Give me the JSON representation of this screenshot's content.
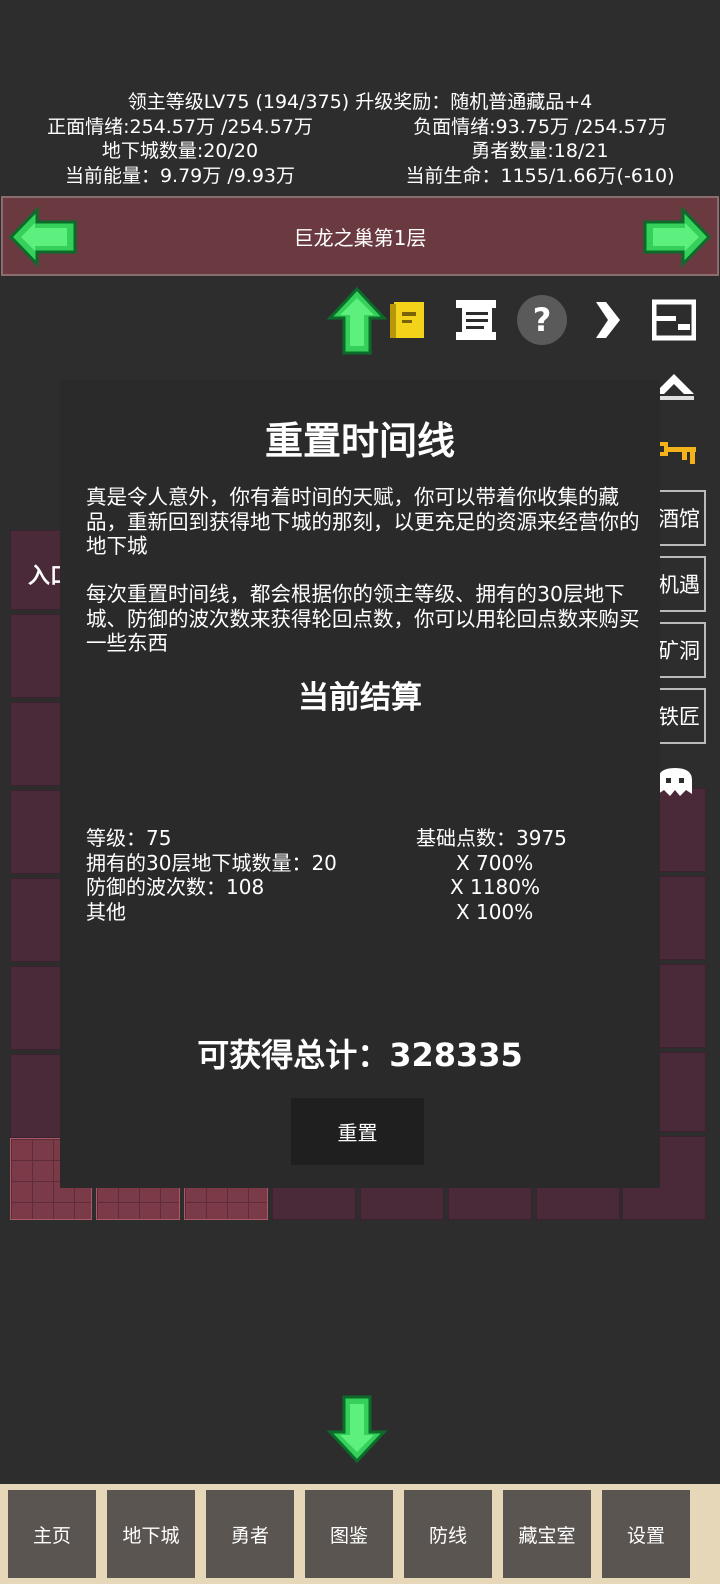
{
  "stats": {
    "lord_line": "领主等级LV75 (194/375) 升级奖励：随机普通藏品+4",
    "positive": "正面情绪:254.57万 /254.57万",
    "negative": "负面情绪:93.75万 /254.57万",
    "dungeon_count": "地下城数量:20/20",
    "hero_count": "勇者数量:18/21",
    "energy": "当前能量：9.79万 /9.93万",
    "life": "当前生命：1155/1.66万(-610)"
  },
  "banner": {
    "title": "巨龙之巢第1层"
  },
  "background": {
    "entrance_label": "入口",
    "right_tabs": [
      "酒馆",
      "机遇",
      "矿洞",
      "铁匠"
    ]
  },
  "dialog": {
    "title": "重置时间线",
    "para1": "  真是令人意外，你有着时间的天赋，你可以带着你收集的藏品，重新回到获得地下城的那刻，以更充足的资源来经营你的地下城",
    "para2": "  每次重置时间线，都会根据你的领主等级、拥有的30层地下城、防御的波次数来获得轮回点数，你可以用轮回点数来购买一些东西",
    "subtitle": "当前结算",
    "calc": [
      {
        "left": "等级：75",
        "right": "基础点数：3975"
      },
      {
        "left": "拥有的30层地下城数量：20",
        "right": "X 700%"
      },
      {
        "left": "防御的波次数：108",
        "right": "X 1180%"
      },
      {
        "left": "其他",
        "right": "X 100%"
      }
    ],
    "total": "可获得总计：328335",
    "reset_label": "重置"
  },
  "nav": {
    "items": [
      "主页",
      "地下城",
      "勇者",
      "图鉴",
      "防线",
      "藏宝室",
      "设置"
    ]
  },
  "colors": {
    "background": "#2d2d2d",
    "banner": "#6b3a40",
    "arrow_green": "#34d05a",
    "nav_bar": "#e6d7b8",
    "nav_button": "#5a5551"
  }
}
